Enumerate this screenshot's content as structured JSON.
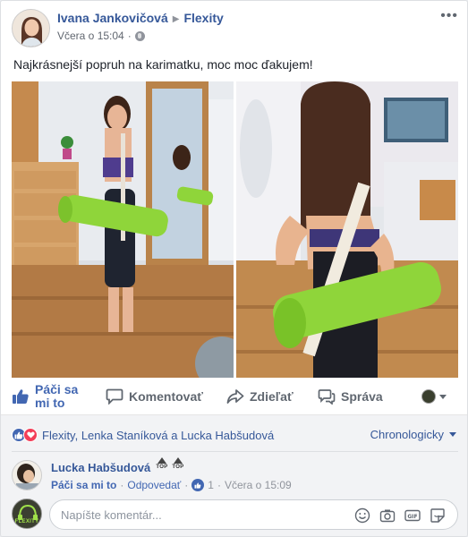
{
  "post": {
    "author": "Ivana Jankovičová",
    "page": "Flexity",
    "timestamp": "Včera o 15:04",
    "text": "Najkrásnejší popruh na karimatku, moc moc ďakujem!",
    "more_icon": "more-horizontal-icon"
  },
  "actions": {
    "like": "Páči sa mi to",
    "comment": "Komentovať",
    "share": "Zdieľať",
    "message": "Správa"
  },
  "reactions": {
    "names": "Flexity, Lenka Staníková a Lucka Habšudová",
    "sort": "Chronologicky",
    "icons": [
      "like-icon",
      "love-icon"
    ]
  },
  "comment": {
    "author": "Lucka Habšudová",
    "badges": [
      "TOP",
      "TOP"
    ],
    "like": "Páči sa mi to",
    "reply": "Odpovedať",
    "separator": "·",
    "like_count": "1",
    "timestamp": "Včera o 15:09"
  },
  "composer": {
    "placeholder": "Napíšte komentár...",
    "avatar_logo": "FLEXITY"
  },
  "colors": {
    "link": "#365899",
    "accent": "#4267b2",
    "love": "#f33e58",
    "mat_green": "#8fd53a"
  }
}
